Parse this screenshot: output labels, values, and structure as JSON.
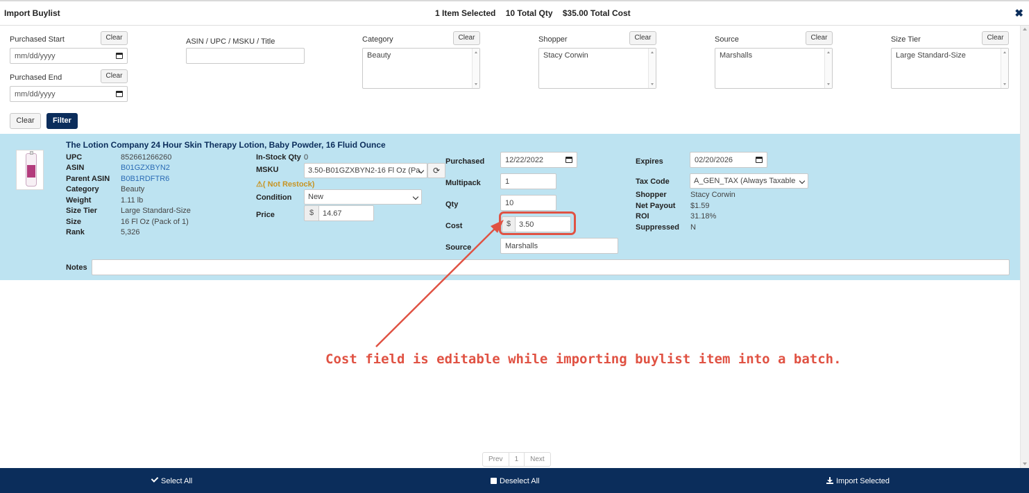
{
  "header": {
    "title": "Import Buylist",
    "items_selected": "1 Item Selected",
    "total_qty": "10 Total Qty",
    "total_cost": "$35.00 Total Cost"
  },
  "filters": {
    "clear_label": "Clear",
    "purchased_start": {
      "label": "Purchased Start",
      "placeholder": "mm/dd/yyyy"
    },
    "purchased_end": {
      "label": "Purchased End",
      "placeholder": "mm/dd/yyyy"
    },
    "search": {
      "label": "ASIN / UPC / MSKU / Title",
      "value": ""
    },
    "category": {
      "label": "Category",
      "selected": "Beauty"
    },
    "shopper": {
      "label": "Shopper",
      "selected": "Stacy Corwin"
    },
    "source": {
      "label": "Source",
      "selected": "Marshalls"
    },
    "size_tier": {
      "label": "Size Tier",
      "selected": "Large Standard-Size"
    },
    "clear_button": "Clear",
    "filter_button": "Filter"
  },
  "item": {
    "title": "The Lotion Company 24 Hour Skin Therapy Lotion, Baby Powder, 16 Fluid Ounce",
    "details": {
      "upc_label": "UPC",
      "upc": "852661266260",
      "asin_label": "ASIN",
      "asin": "B01GZXBYN2",
      "parent_asin_label": "Parent ASIN",
      "parent_asin": "B0B1RDFTR6",
      "category_label": "Category",
      "category": "Beauty",
      "weight_label": "Weight",
      "weight": "1.11 lb",
      "size_tier_label": "Size Tier",
      "size_tier": "Large Standard-Size",
      "size_label": "Size",
      "size": "16 Fl Oz (Pack of 1)",
      "rank_label": "Rank",
      "rank": "5,326"
    },
    "in_stock_label": "In-Stock Qty",
    "in_stock": "0",
    "msku_label": "MSKU",
    "msku": "3.50-B01GZXBYN2-16 Fl Oz (Pa",
    "warning": "( Not Restock)",
    "condition_label": "Condition",
    "condition": "New",
    "price_label": "Price",
    "currency": "$",
    "price": "14.67",
    "purchased_label": "Purchased",
    "purchased": "12/22/2022",
    "multipack_label": "Multipack",
    "multipack": "1",
    "qty_label": "Qty",
    "qty": "10",
    "cost_label": "Cost",
    "cost": "3.50",
    "source_label": "Source",
    "source": "Marshalls",
    "expires_label": "Expires",
    "expires": "02/20/2026",
    "tax_code_label": "Tax Code",
    "tax_code": "A_GEN_TAX (Always Taxable",
    "shopper_label": "Shopper",
    "shopper": "Stacy Corwin",
    "net_payout_label": "Net Payout",
    "net_payout": "$1.59",
    "roi_label": "ROI",
    "roi": "31.18%",
    "suppressed_label": "Suppressed",
    "suppressed": "N",
    "notes_label": "Notes",
    "notes": "",
    "warning_color": "#c79424"
  },
  "annotation": "Cost field is editable while importing buylist item into a batch.",
  "annotation_color": "#e05243",
  "pagination": {
    "prev": "Prev",
    "page": "1",
    "next": "Next"
  },
  "footer": {
    "select_all": "Select All",
    "deselect_all": "Deselect All",
    "import_selected": "Import Selected"
  },
  "colors": {
    "brand": "#0b2d5b",
    "item_row": "#bde3f1",
    "link": "#2a6bb5"
  }
}
